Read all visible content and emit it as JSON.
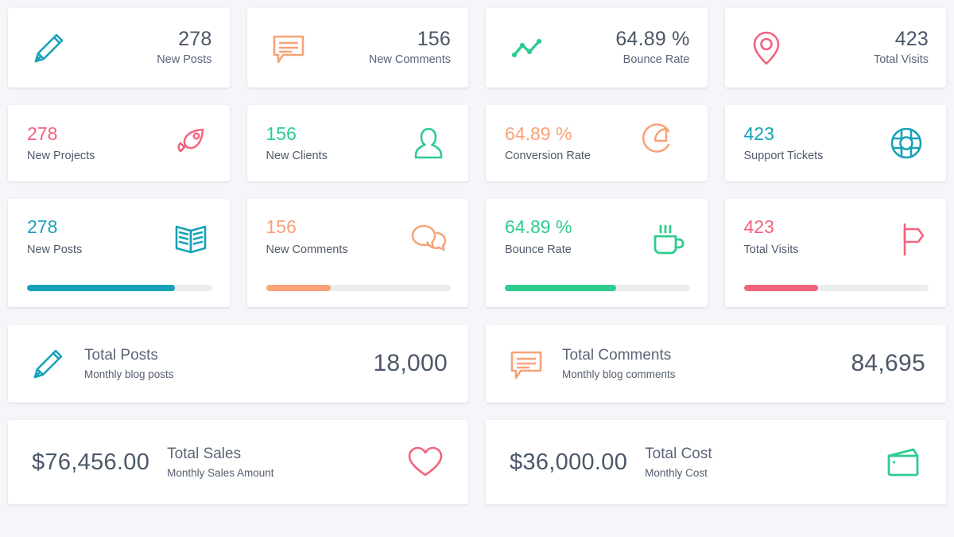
{
  "colors": {
    "background": "#f4f6f9",
    "card": "#ffffff",
    "teal": "#17a2b8",
    "teal_dark": "#13a3b5",
    "orange": "#f7a278",
    "green": "#2ecc8f",
    "pink": "#f2637f",
    "text_dark": "#4b5668",
    "text_muted": "#55606f",
    "track": "#eceded"
  },
  "row1": {
    "cards": [
      {
        "icon": "pencil-icon",
        "value": "278",
        "label": "New Posts",
        "color": "#17a2b8"
      },
      {
        "icon": "comment-icon",
        "value": "156",
        "label": "New Comments",
        "color": "#f7a278"
      },
      {
        "icon": "line-chart-icon",
        "value": "64.89 %",
        "label": "Bounce Rate",
        "color": "#2ecc8f"
      },
      {
        "icon": "map-pin-icon",
        "value": "423",
        "label": "Total Visits",
        "color": "#f2637f"
      }
    ]
  },
  "row2": {
    "cards": [
      {
        "icon": "rocket-icon",
        "value": "278",
        "label": "New Projects",
        "color": "#f2637f"
      },
      {
        "icon": "user-icon",
        "value": "156",
        "label": "New Clients",
        "color": "#2ecc8f"
      },
      {
        "icon": "pie-chart-icon",
        "value": "64.89 %",
        "label": "Conversion Rate",
        "color": "#f7a278"
      },
      {
        "icon": "lifebuoy-icon",
        "value": "423",
        "label": "Support Tickets",
        "color": "#17a2b8"
      }
    ]
  },
  "row3": {
    "cards": [
      {
        "icon": "book-icon",
        "value": "278",
        "label": "New Posts",
        "color": "#17a2b8",
        "progress": 80
      },
      {
        "icon": "chat-bubbles-icon",
        "value": "156",
        "label": "New Comments",
        "color": "#f7a278",
        "progress": 35
      },
      {
        "icon": "coffee-cup-icon",
        "value": "64.89 %",
        "label": "Bounce Rate",
        "color": "#2ecc8f",
        "progress": 60
      },
      {
        "icon": "signpost-icon",
        "value": "423",
        "label": "Total Visits",
        "color": "#f2637f",
        "progress": 40
      }
    ]
  },
  "row4": {
    "cards": [
      {
        "icon": "pencil-icon",
        "title": "Total Posts",
        "subtitle": "Monthly blog posts",
        "value": "18,000",
        "color": "#17a2b8"
      },
      {
        "icon": "comment-icon",
        "title": "Total Comments",
        "subtitle": "Monthly blog comments",
        "value": "84,695",
        "color": "#f7a278"
      }
    ]
  },
  "row5": {
    "cards": [
      {
        "icon": "heart-icon",
        "title": "Total Sales",
        "subtitle": "Monthly Sales Amount",
        "value": "$76,456.00",
        "color": "#f2637f"
      },
      {
        "icon": "wallet-icon",
        "title": "Total Cost",
        "subtitle": "Monthly Cost",
        "value": "$36,000.00",
        "color": "#2ecc8f"
      }
    ]
  }
}
